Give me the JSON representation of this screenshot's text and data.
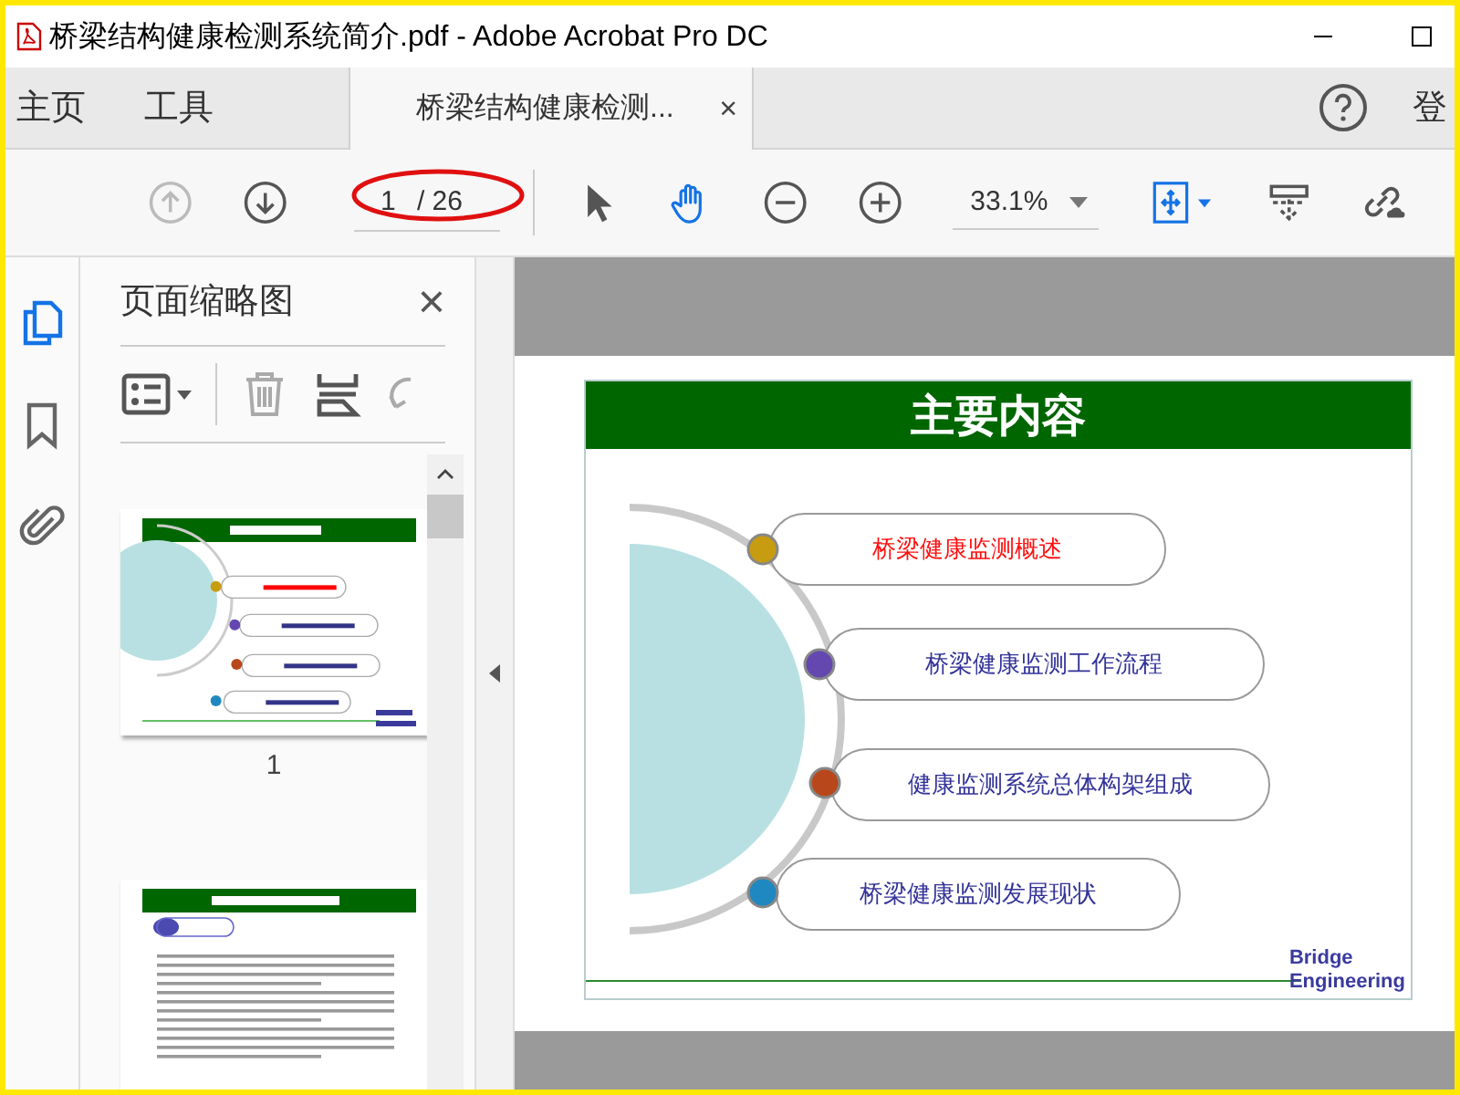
{
  "window": {
    "title": "桥梁结构健康检测系统简介.pdf - Adobe Acrobat Pro DC"
  },
  "nav": [
    {
      "label": "主页",
      "selected": false
    },
    {
      "label": "工具",
      "selected": false
    }
  ],
  "document_tab": {
    "label": "桥梁结构健康检测...",
    "close": "×",
    "selected": true
  },
  "sign_in": "登",
  "toolbar": {
    "prev_disabled": true,
    "page": {
      "value": "1",
      "total": "/ 26",
      "circled": true
    },
    "tools": [
      {
        "kind": "select",
        "selected": false
      },
      {
        "kind": "hand",
        "selected": true
      }
    ],
    "zoom": "33.1%"
  },
  "sidebar": {
    "rail": [
      {
        "kind": "pages",
        "selected": true
      },
      {
        "kind": "bookmarks",
        "selected": false
      },
      {
        "kind": "attachments",
        "selected": false
      }
    ],
    "panel": {
      "title": "页面缩略图",
      "close": "×"
    },
    "thumbnails": [
      {
        "kind": "contents",
        "label": "1"
      },
      {
        "kind": "text"
      }
    ]
  },
  "slide": {
    "title": "主要内容",
    "items": [
      {
        "text": "桥梁健康监测概述",
        "color": "#c89c10",
        "highlighted": true
      },
      {
        "text": "桥梁健康监测工作流程",
        "color": "#6448b0",
        "highlighted": false
      },
      {
        "text": "健康监测系统总体构架组成",
        "color": "#b8481c",
        "highlighted": false
      },
      {
        "text": "桥梁健康监测发展现状",
        "color": "#2088c0",
        "highlighted": false
      }
    ],
    "logo": [
      "Bridge",
      "Engineering"
    ]
  }
}
